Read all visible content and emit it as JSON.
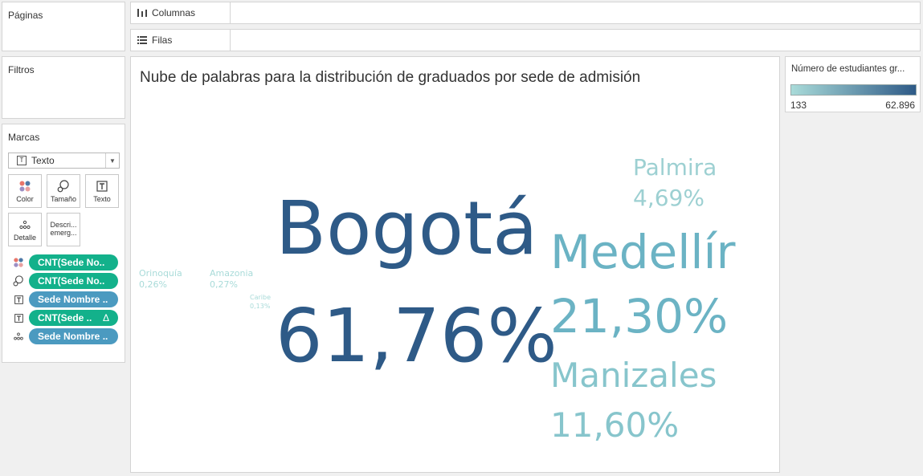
{
  "pages": {
    "title": "Páginas"
  },
  "filters": {
    "title": "Filtros"
  },
  "shelves": {
    "columns": {
      "label": "Columnas",
      "icon": "columns-icon"
    },
    "rows": {
      "label": "Filas",
      "icon": "rows-icon"
    }
  },
  "marks": {
    "title": "Marcas",
    "mark_type": "Texto",
    "buttons": {
      "color": "Color",
      "size": "Tamaño",
      "text": "Texto",
      "detail": "Detalle",
      "tooltip_line1": "Descri...",
      "tooltip_line2": "emerg..."
    },
    "pills": [
      {
        "label": "CNT(Sede No..",
        "icon": "color-icon",
        "kind": "measure"
      },
      {
        "label": "CNT(Sede No..",
        "icon": "size-icon",
        "kind": "measure"
      },
      {
        "label": "Sede Nombre ..",
        "icon": "text-icon",
        "kind": "dimension"
      },
      {
        "label": "CNT(Sede ..",
        "icon": "text-icon",
        "kind": "measure",
        "delta": "Δ"
      },
      {
        "label": "Sede Nombre ..",
        "icon": "detail-icon",
        "kind": "dimension"
      }
    ]
  },
  "legend": {
    "title": "Número de estudiantes gr...",
    "min": "133",
    "max": "62.896",
    "color_low": "#a9dbd9",
    "color_high": "#2e5a87"
  },
  "viz": {
    "title": "Nube de palabras para la distribución de graduados por sede de admisión"
  },
  "chart_data": {
    "type": "word_cloud",
    "measure": "Número de estudiantes graduados",
    "color_range": [
      133,
      62896
    ],
    "words": [
      {
        "name": "Bogotá",
        "share": "61,76%",
        "value": 62896
      },
      {
        "name": "Medellír",
        "share": "21,30%"
      },
      {
        "name": "Manizales",
        "share": "11,60%"
      },
      {
        "name": "Palmira",
        "share": "4,69%"
      },
      {
        "name": "Amazonia",
        "share": "0,27%"
      },
      {
        "name": "Orinoquía",
        "share": "0,26%"
      },
      {
        "name": "Caribe",
        "share": "0,13%",
        "value": 133
      }
    ]
  }
}
